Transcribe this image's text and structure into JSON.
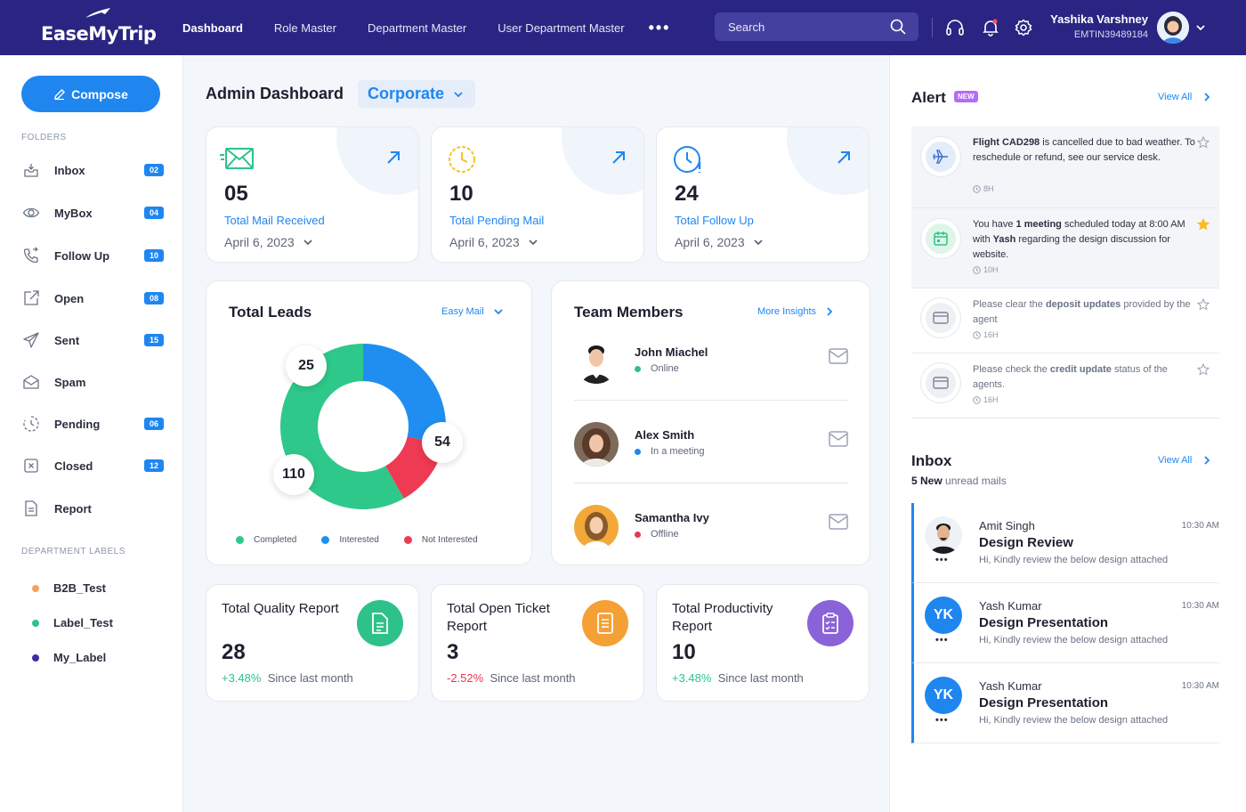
{
  "brand": {
    "name": "EaseMyTrip"
  },
  "nav": {
    "items": [
      "Dashboard",
      "Role Master",
      "Department Master",
      "User Department Master"
    ],
    "more": "•••"
  },
  "search": {
    "placeholder": "Search"
  },
  "user": {
    "name": "Yashika Varshney",
    "id": "EMTIN39489184"
  },
  "sidebar": {
    "compose": "Compose",
    "folders_label": "FOLDERS",
    "folders": [
      {
        "label": "Inbox",
        "badge": "02",
        "icon": "inbox-icon"
      },
      {
        "label": "MyBox",
        "badge": "04",
        "icon": "eye-icon"
      },
      {
        "label": "Follow Up",
        "badge": "10",
        "icon": "phone-icon"
      },
      {
        "label": "Open",
        "badge": "08",
        "icon": "open-icon"
      },
      {
        "label": "Sent",
        "badge": "15",
        "icon": "send-icon"
      },
      {
        "label": "Spam",
        "badge": "",
        "icon": "spam-icon"
      },
      {
        "label": "Pending",
        "badge": "06",
        "icon": "pending-icon"
      },
      {
        "label": "Closed",
        "badge": "12",
        "icon": "closed-icon"
      },
      {
        "label": "Report",
        "badge": "",
        "icon": "report-icon"
      }
    ],
    "dept_label": "DEPARTMENT LABELS",
    "dept": [
      {
        "label": "B2B_Test",
        "color": "#f5a35c"
      },
      {
        "label": "Label_Test",
        "color": "#2ec28a"
      },
      {
        "label": "My_Label",
        "color": "#3a2fa0"
      }
    ]
  },
  "main": {
    "title": "Admin Dashboard",
    "corporate": "Corporate",
    "stats": [
      {
        "value": "05",
        "label": "Total Mail Received",
        "date": "April 6, 2023"
      },
      {
        "value": "10",
        "label": "Total Pending Mail",
        "date": "April 6, 2023"
      },
      {
        "value": "24",
        "label": "Total Follow Up",
        "date": "April 6, 2023"
      }
    ],
    "leads": {
      "title": "Total Leads",
      "filter": "Easy Mail"
    },
    "team": {
      "title": "Team Members",
      "link": "More Insights",
      "members": [
        {
          "name": "John Miachel",
          "status": "Online",
          "color": "#2ec28a"
        },
        {
          "name": "Alex Smith",
          "status": "In a meeting",
          "color": "#1f86f0"
        },
        {
          "name": "Samantha Ivy",
          "status": "Offline",
          "color": "#e8374f"
        }
      ]
    },
    "reports": [
      {
        "title": "Total Quality Report",
        "value": "28",
        "change": "+3.48%",
        "since": "Since last month",
        "color": "#2ec28a"
      },
      {
        "title": "Total Open Ticket Report",
        "value": "3",
        "change": "-2.52%",
        "since": "Since last month",
        "color": "#f5a035"
      },
      {
        "title": "Total Productivity Report",
        "value": "10",
        "change": "+3.48%",
        "since": "Since last month",
        "color": "#8a63d8"
      }
    ]
  },
  "chart_data": {
    "type": "pie",
    "title": "Total Leads",
    "categories": [
      "Interested",
      "Not Interested",
      "Completed"
    ],
    "values": [
      54,
      25,
      110
    ],
    "colors": [
      "#1f8ef0",
      "#ee3a52",
      "#2ec98a"
    ],
    "legend": [
      "Completed",
      "Interested",
      "Not Interested"
    ],
    "legend_colors": [
      "#2ec98a",
      "#1f8ef0",
      "#ee3a52"
    ],
    "legend_position": "bottom"
  },
  "alerts": {
    "title": "Alert",
    "badge": "NEW",
    "view_all": "View All",
    "items": [
      {
        "parts": [
          [
            "b",
            "Flight CAD298"
          ],
          [
            "t",
            " is cancelled due to bad weather. To reschedule or refund, see our service desk."
          ]
        ],
        "time": "8H",
        "starred": false
      },
      {
        "parts": [
          [
            "t",
            "You have "
          ],
          [
            "b",
            "1 meeting"
          ],
          [
            "t",
            " scheduled today at 8:00 AM with "
          ],
          [
            "b",
            "Yash"
          ],
          [
            "t",
            " regarding the design discussion for website."
          ]
        ],
        "time": "10H",
        "starred": true
      },
      {
        "parts": [
          [
            "t",
            "Please clear the "
          ],
          [
            "b",
            "deposit updates"
          ],
          [
            "t",
            " provided by the agent"
          ]
        ],
        "time": "16H",
        "starred": false
      },
      {
        "parts": [
          [
            "t",
            "Please check the "
          ],
          [
            "b",
            "credit update"
          ],
          [
            "t",
            " status of the agents."
          ]
        ],
        "time": "16H",
        "starred": false
      }
    ]
  },
  "inbox": {
    "title": "Inbox",
    "view_all": "View All",
    "unread_count": "5 New",
    "unread_text": " unread mails",
    "items": [
      {
        "from": "Amit Singh",
        "subject": "Design Review",
        "preview": "Hi, Kindly review the below design attached",
        "time": "10:30 AM",
        "initials": ""
      },
      {
        "from": "Yash Kumar",
        "subject": "Design Presentation",
        "preview": "Hi, Kindly review the below design attached",
        "time": "10:30 AM",
        "initials": "YK"
      },
      {
        "from": "Yash Kumar",
        "subject": "Design Presentation",
        "preview": "Hi, Kindly review the below design attached",
        "time": "10:30 AM",
        "initials": "YK"
      }
    ]
  }
}
